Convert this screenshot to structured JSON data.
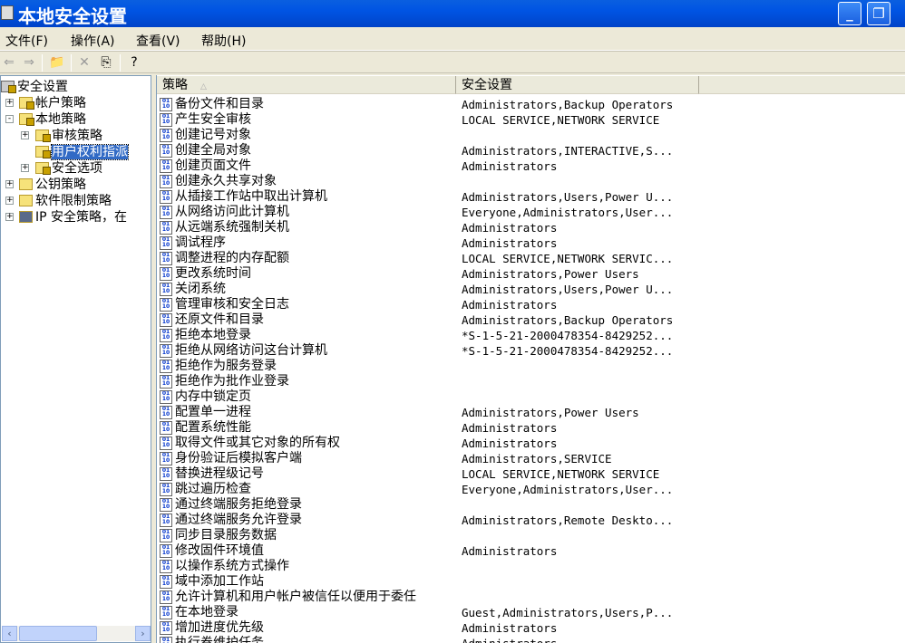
{
  "window": {
    "title": "本地安全设置"
  },
  "menu": [
    "文件(F)",
    "操作(A)",
    "查看(V)",
    "帮助(H)"
  ],
  "tree": [
    {
      "label": "安全设置",
      "level": 0,
      "expander": "",
      "icon": "security-settings-icon"
    },
    {
      "label": "帐户策略",
      "level": 1,
      "expander": "+",
      "icon": "locked-folder-icon"
    },
    {
      "label": "本地策略",
      "level": 1,
      "expander": "-",
      "icon": "locked-folder-icon"
    },
    {
      "label": "审核策略",
      "level": 2,
      "expander": "+",
      "icon": "locked-folder-icon"
    },
    {
      "label": "用户权利指派",
      "level": 2,
      "expander": "",
      "icon": "locked-folder-icon",
      "selected": true
    },
    {
      "label": "安全选项",
      "level": 2,
      "expander": "+",
      "icon": "locked-folder-icon"
    },
    {
      "label": "公钥策略",
      "level": 1,
      "expander": "+",
      "icon": "folder-icon"
    },
    {
      "label": "软件限制策略",
      "level": 1,
      "expander": "+",
      "icon": "folder-icon"
    },
    {
      "label": "IP 安全策略，在",
      "level": 1,
      "expander": "+",
      "icon": "ip-security-icon"
    }
  ],
  "columns": {
    "policy": "策略",
    "setting": "安全设置"
  },
  "policies": [
    [
      "备份文件和目录",
      "Administrators,Backup Operators"
    ],
    [
      "产生安全审核",
      "LOCAL SERVICE,NETWORK SERVICE"
    ],
    [
      "创建记号对象",
      ""
    ],
    [
      "创建全局对象",
      "Administrators,INTERACTIVE,S..."
    ],
    [
      "创建页面文件",
      "Administrators"
    ],
    [
      "创建永久共享对象",
      ""
    ],
    [
      "从插接工作站中取出计算机",
      "Administrators,Users,Power U..."
    ],
    [
      "从网络访问此计算机",
      "Everyone,Administrators,User..."
    ],
    [
      "从远端系统强制关机",
      "Administrators"
    ],
    [
      "调试程序",
      "Administrators"
    ],
    [
      "调整进程的内存配额",
      "LOCAL SERVICE,NETWORK SERVIC..."
    ],
    [
      "更改系统时间",
      "Administrators,Power Users"
    ],
    [
      "关闭系统",
      "Administrators,Users,Power U..."
    ],
    [
      "管理审核和安全日志",
      "Administrators"
    ],
    [
      "还原文件和目录",
      "Administrators,Backup Operators"
    ],
    [
      "拒绝本地登录",
      "*S-1-5-21-2000478354-8429252..."
    ],
    [
      "拒绝从网络访问这台计算机",
      "*S-1-5-21-2000478354-8429252..."
    ],
    [
      "拒绝作为服务登录",
      ""
    ],
    [
      "拒绝作为批作业登录",
      ""
    ],
    [
      "内存中锁定页",
      ""
    ],
    [
      "配置单一进程",
      "Administrators,Power Users"
    ],
    [
      "配置系统性能",
      "Administrators"
    ],
    [
      "取得文件或其它对象的所有权",
      "Administrators"
    ],
    [
      "身份验证后模拟客户端",
      "Administrators,SERVICE"
    ],
    [
      "替换进程级记号",
      "LOCAL SERVICE,NETWORK SERVICE"
    ],
    [
      "跳过遍历检查",
      "Everyone,Administrators,User..."
    ],
    [
      "通过终端服务拒绝登录",
      ""
    ],
    [
      "通过终端服务允许登录",
      "Administrators,Remote Deskto..."
    ],
    [
      "同步目录服务数据",
      ""
    ],
    [
      "修改固件环境值",
      "Administrators"
    ],
    [
      "以操作系统方式操作",
      ""
    ],
    [
      "域中添加工作站",
      ""
    ],
    [
      "允许计算机和用户帐户被信任以便用于委任",
      ""
    ],
    [
      "在本地登录",
      "Guest,Administrators,Users,P..."
    ],
    [
      "增加进度优先级",
      "Administrators"
    ],
    [
      "执行卷维护任务",
      "Administrators"
    ]
  ]
}
